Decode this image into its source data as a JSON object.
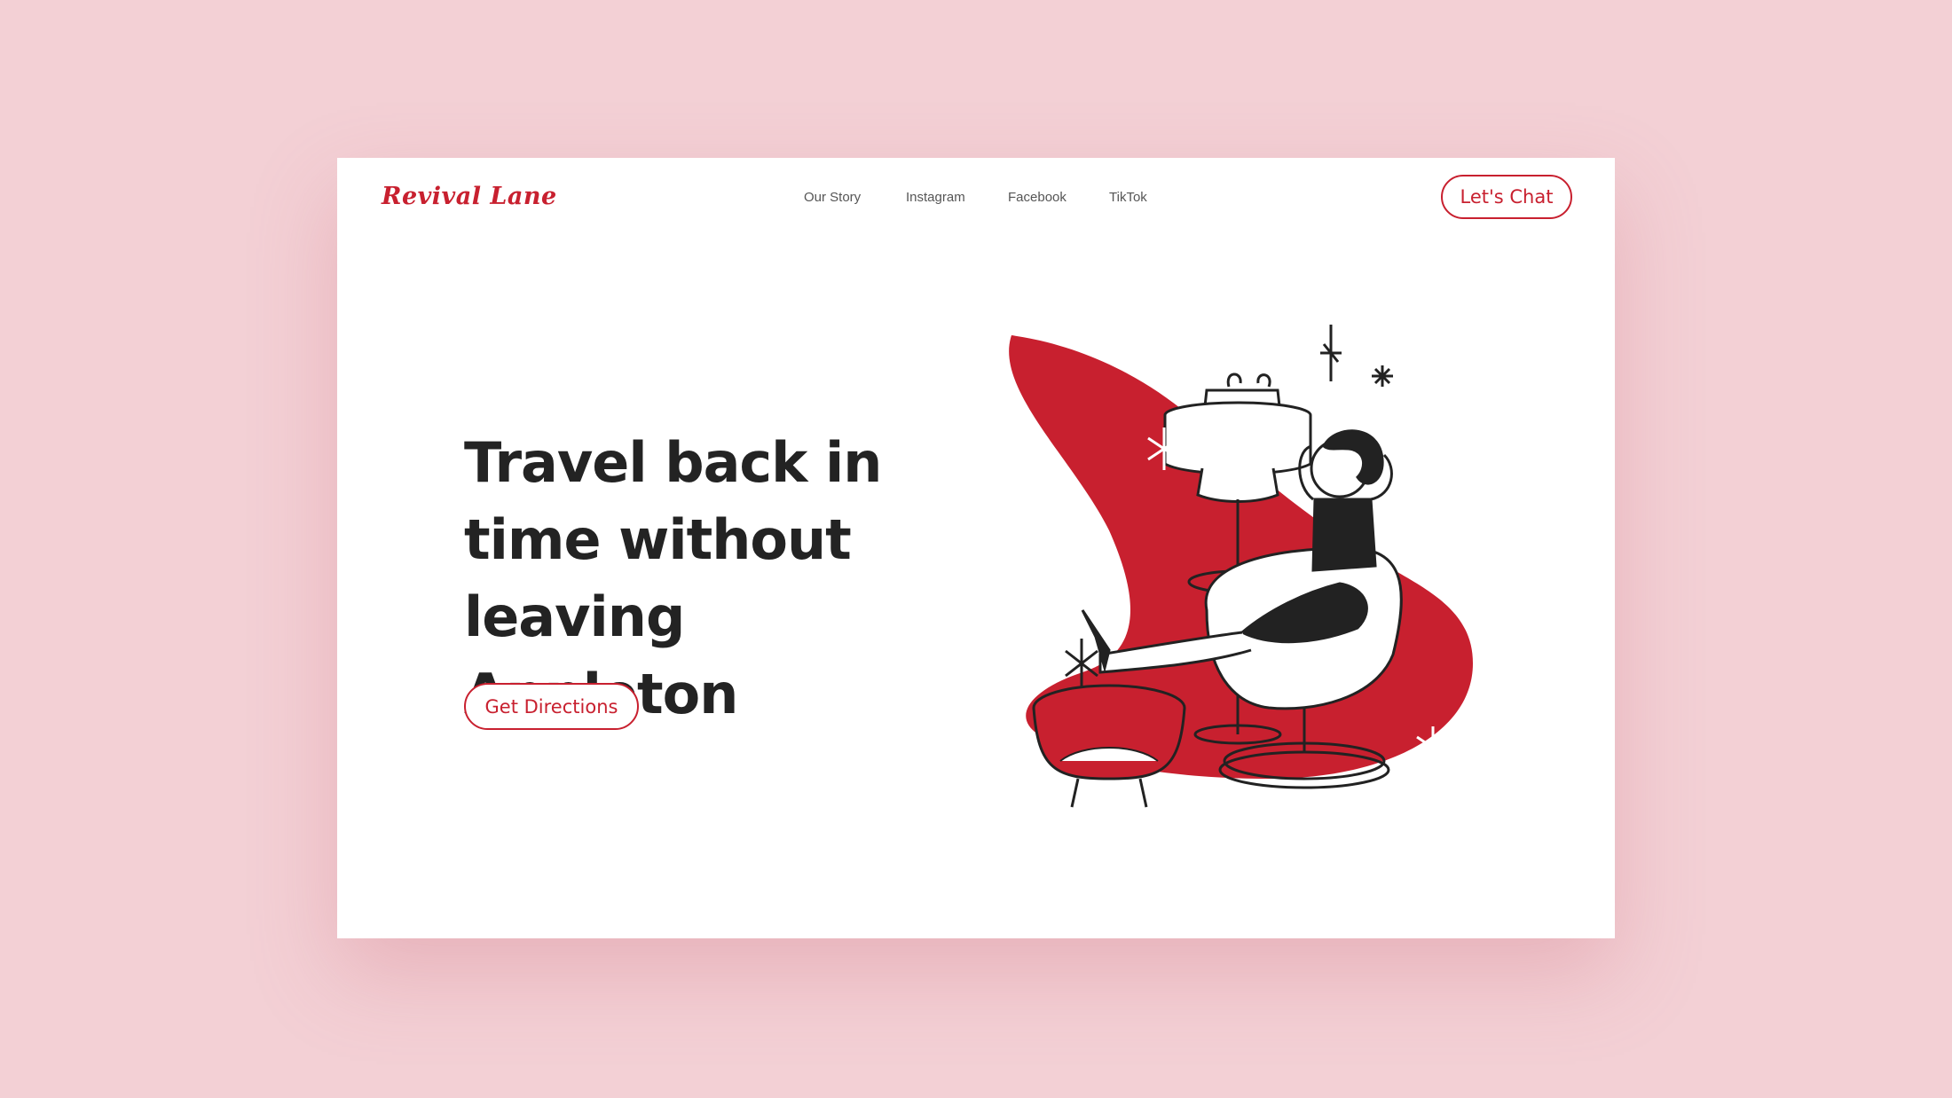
{
  "brand": {
    "logo_text": "Revival Lane",
    "accent_color": "#c8202f"
  },
  "nav": {
    "items": [
      {
        "label": "Our Story"
      },
      {
        "label": "Instagram"
      },
      {
        "label": "Facebook"
      },
      {
        "label": "TikTok"
      }
    ],
    "cta_label": "Let's Chat"
  },
  "hero": {
    "headline_lines": [
      "Travel back in",
      "time without",
      "leaving Appleton"
    ],
    "cta_label": "Get Directions"
  },
  "illustration": {
    "icons": [
      "boomerang-shape",
      "lamp",
      "woman-in-chair",
      "ottoman",
      "sparkle-stars"
    ]
  }
}
